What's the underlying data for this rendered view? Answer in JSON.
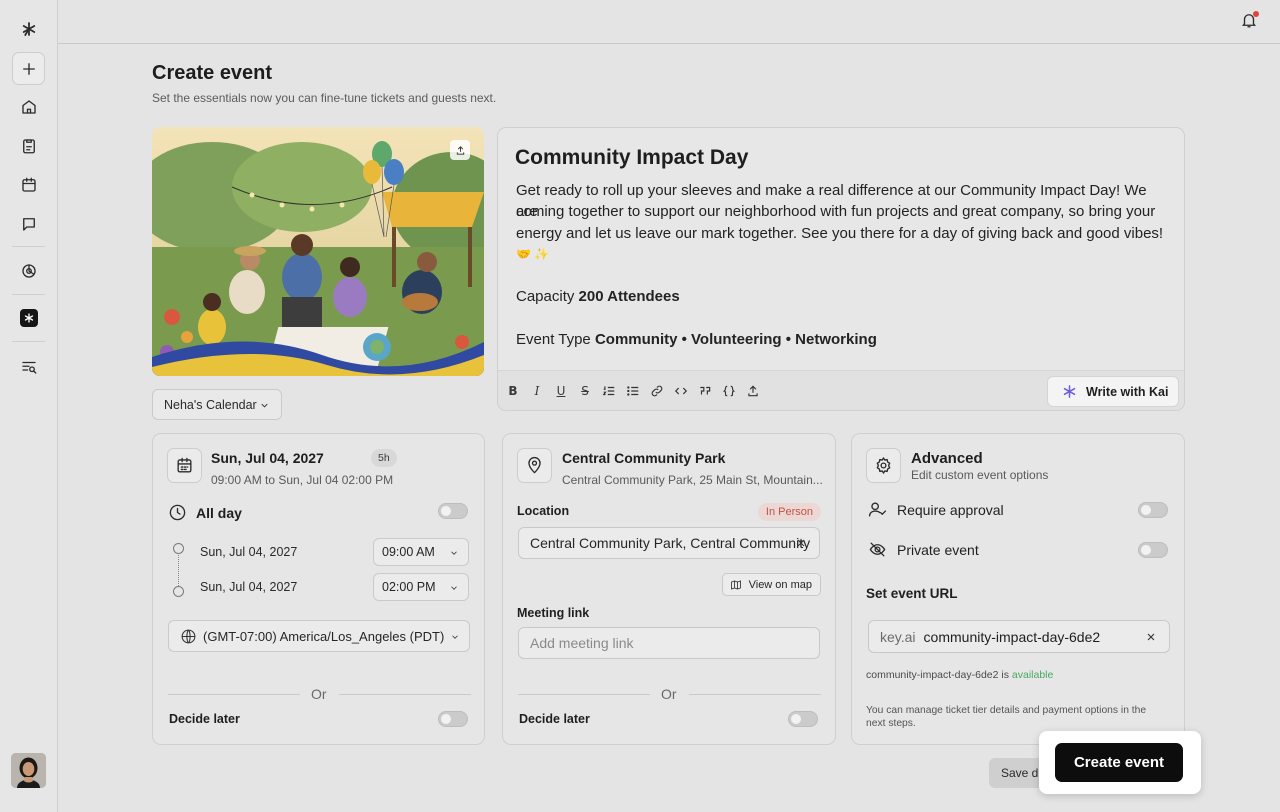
{
  "app": {
    "notifications_dot_color": "#e0443a",
    "accent_color": "#6b5ce7"
  },
  "sidebar": {
    "items": [
      {
        "icon": "logo-icon"
      },
      {
        "icon": "plus-icon"
      },
      {
        "icon": "home-icon"
      },
      {
        "icon": "clipboard-icon"
      },
      {
        "icon": "calendar-icon"
      },
      {
        "icon": "chat-icon"
      },
      {
        "icon": "analytics-icon"
      },
      {
        "icon": "kai-app-icon"
      },
      {
        "icon": "search-list-icon"
      }
    ]
  },
  "header": {
    "title": "Create event",
    "subtitle": "Set the essentials now you can fine-tune tickets and guests next."
  },
  "calendar_select": {
    "value": "Neha's Calendar"
  },
  "description": {
    "event_name": "Community Impact Day",
    "line1": "Get ready to roll up your sleeves and make a real difference at our Community Impact Day! We are",
    "line2": "coming together to support our neighborhood with fun projects and great company, so bring your",
    "line3": "energy and let us leave our mark together. See you there for a day of giving back and good vibes!",
    "line4": "🤝 ✨",
    "capacity_label": "Capacity",
    "capacity_value": "200 Attendees",
    "type_label": "Event Type",
    "type_value": "Community • Volunteering • Networking",
    "write_with_kai": "Write with Kai"
  },
  "date_card": {
    "date": "Sun, Jul 04, 2027",
    "duration": "5h",
    "range": "09:00 AM to Sun, Jul 04 02:00 PM",
    "all_day": "All day",
    "start_date": "Sun, Jul 04, 2027",
    "start_time": "09:00 AM",
    "end_date": "Sun, Jul 04, 2027",
    "end_time": "02:00 PM",
    "timezone": "(GMT-07:00) America/Los_Angeles (PDT)",
    "or": "Or",
    "decide_later": "Decide later"
  },
  "location_card": {
    "name": "Central Community Park",
    "address": "Central Community Park, 25 Main St, Mountain...",
    "location_label": "Location",
    "badge": "In Person",
    "location_value": "Central Community Park, Central Community",
    "view_on_map": "View on map",
    "meeting_label": "Meeting link",
    "meeting_placeholder": "Add meeting link",
    "or": "Or",
    "decide_later": "Decide later"
  },
  "advanced_card": {
    "title": "Advanced",
    "subtitle": "Edit custom event options",
    "require_approval": "Require approval",
    "private_event": "Private event",
    "url_label": "Set event URL",
    "url_prefix": "key.ai",
    "url_value": "community-impact-day-6de2",
    "availability_slug": "community-impact-day-6de2 is",
    "availability_status": "available",
    "note": "You can manage ticket tier details and payment options in the next steps."
  },
  "actions": {
    "save_draft": "Save draft",
    "create_event": "Create event"
  }
}
